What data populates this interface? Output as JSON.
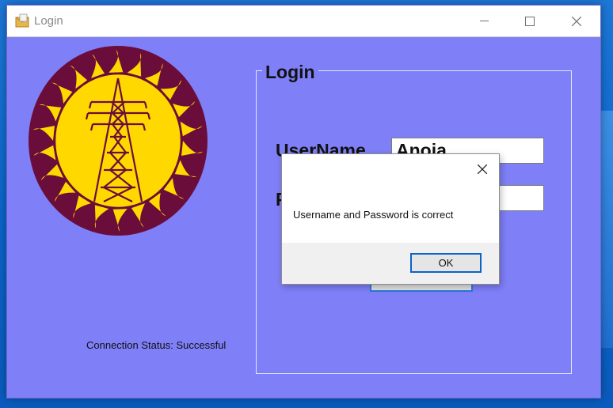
{
  "window": {
    "title": "Login",
    "controls": [
      "minimize",
      "maximize",
      "close"
    ]
  },
  "login": {
    "group_title": "Login",
    "username_label": "UserName",
    "username_value": "Anoja",
    "password_label": "P",
    "password_value": "",
    "login_button_label": ""
  },
  "status": {
    "connection_label": "Connection Status: Successful"
  },
  "dialog": {
    "message": "Username and Password is correct",
    "ok_label": "OK"
  },
  "colors": {
    "window_bg": "#7f7ff8",
    "logo_ring": "#6b0d3a",
    "logo_sun": "#ffd800",
    "accent": "#0a64c8"
  }
}
